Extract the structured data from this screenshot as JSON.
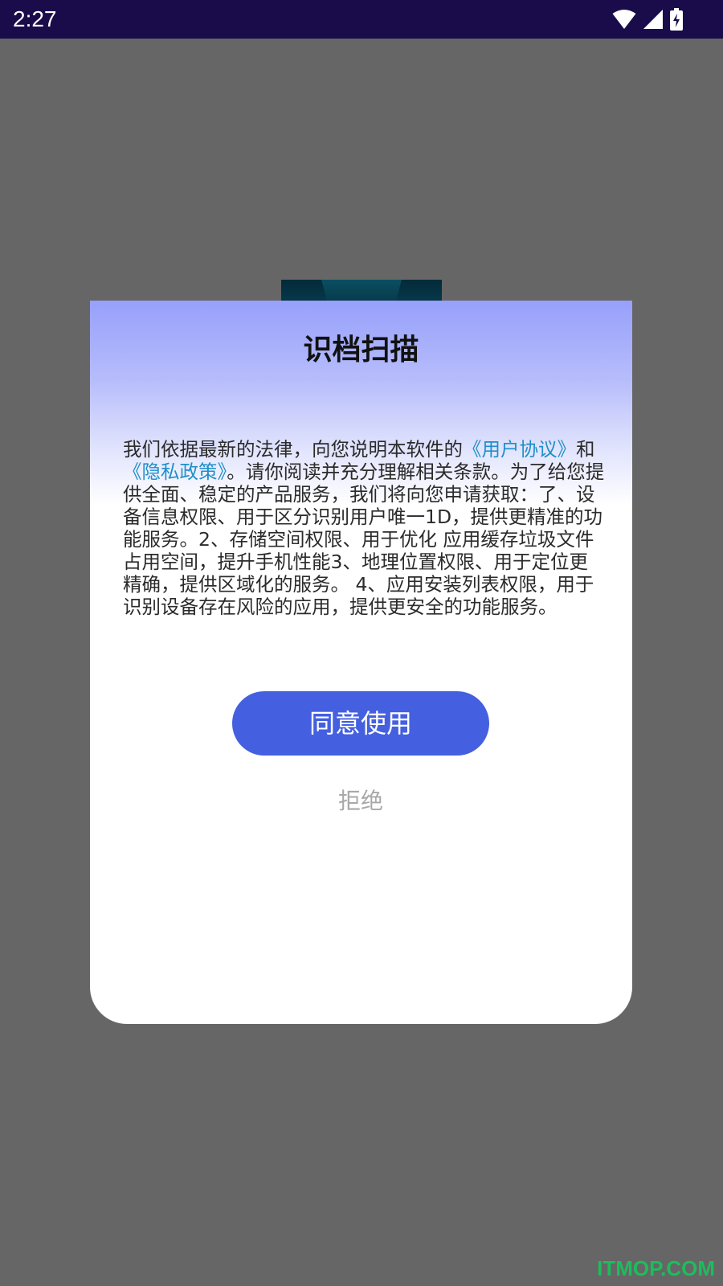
{
  "status_bar": {
    "time": "2:27",
    "icons": [
      "wifi-icon",
      "cellular-signal-icon",
      "battery-charging-icon"
    ]
  },
  "dialog": {
    "title": "识档扫描",
    "body": {
      "text_1": "我们依据最新的法律，向您说明本软件的",
      "link_user_agreement": "《用户协议》",
      "text_2": "和",
      "link_privacy_policy": "《隐私政策》",
      "text_3": "。请你阅读并充分理解相关条款。为了给您提供全面、稳定的产品服务，我们将向您申请获取：了、设备信息权限、用于区分识别用户唯一1D，提供更精准的功能服务。2、存储空间权限、用于优化 应用缓存垃圾文件占用空间，提升手机性能3、地理位置权限、用于定位更精确，提供区域化的服务。 4、应用安装列表权限，用于识别设备存在风险的应用，提供更安全的功能服务。"
    },
    "agree_label": "同意使用",
    "reject_label": "拒绝"
  },
  "watermark": "ITMOP.COM",
  "colors": {
    "status_bar_bg": "#1a0c4a",
    "overlay_bg": "#666666",
    "primary_button": "#4460e0",
    "link": "#1f8fc9",
    "reject_text": "#a8a8a8",
    "header_gradient_top": "#97a0fb"
  }
}
